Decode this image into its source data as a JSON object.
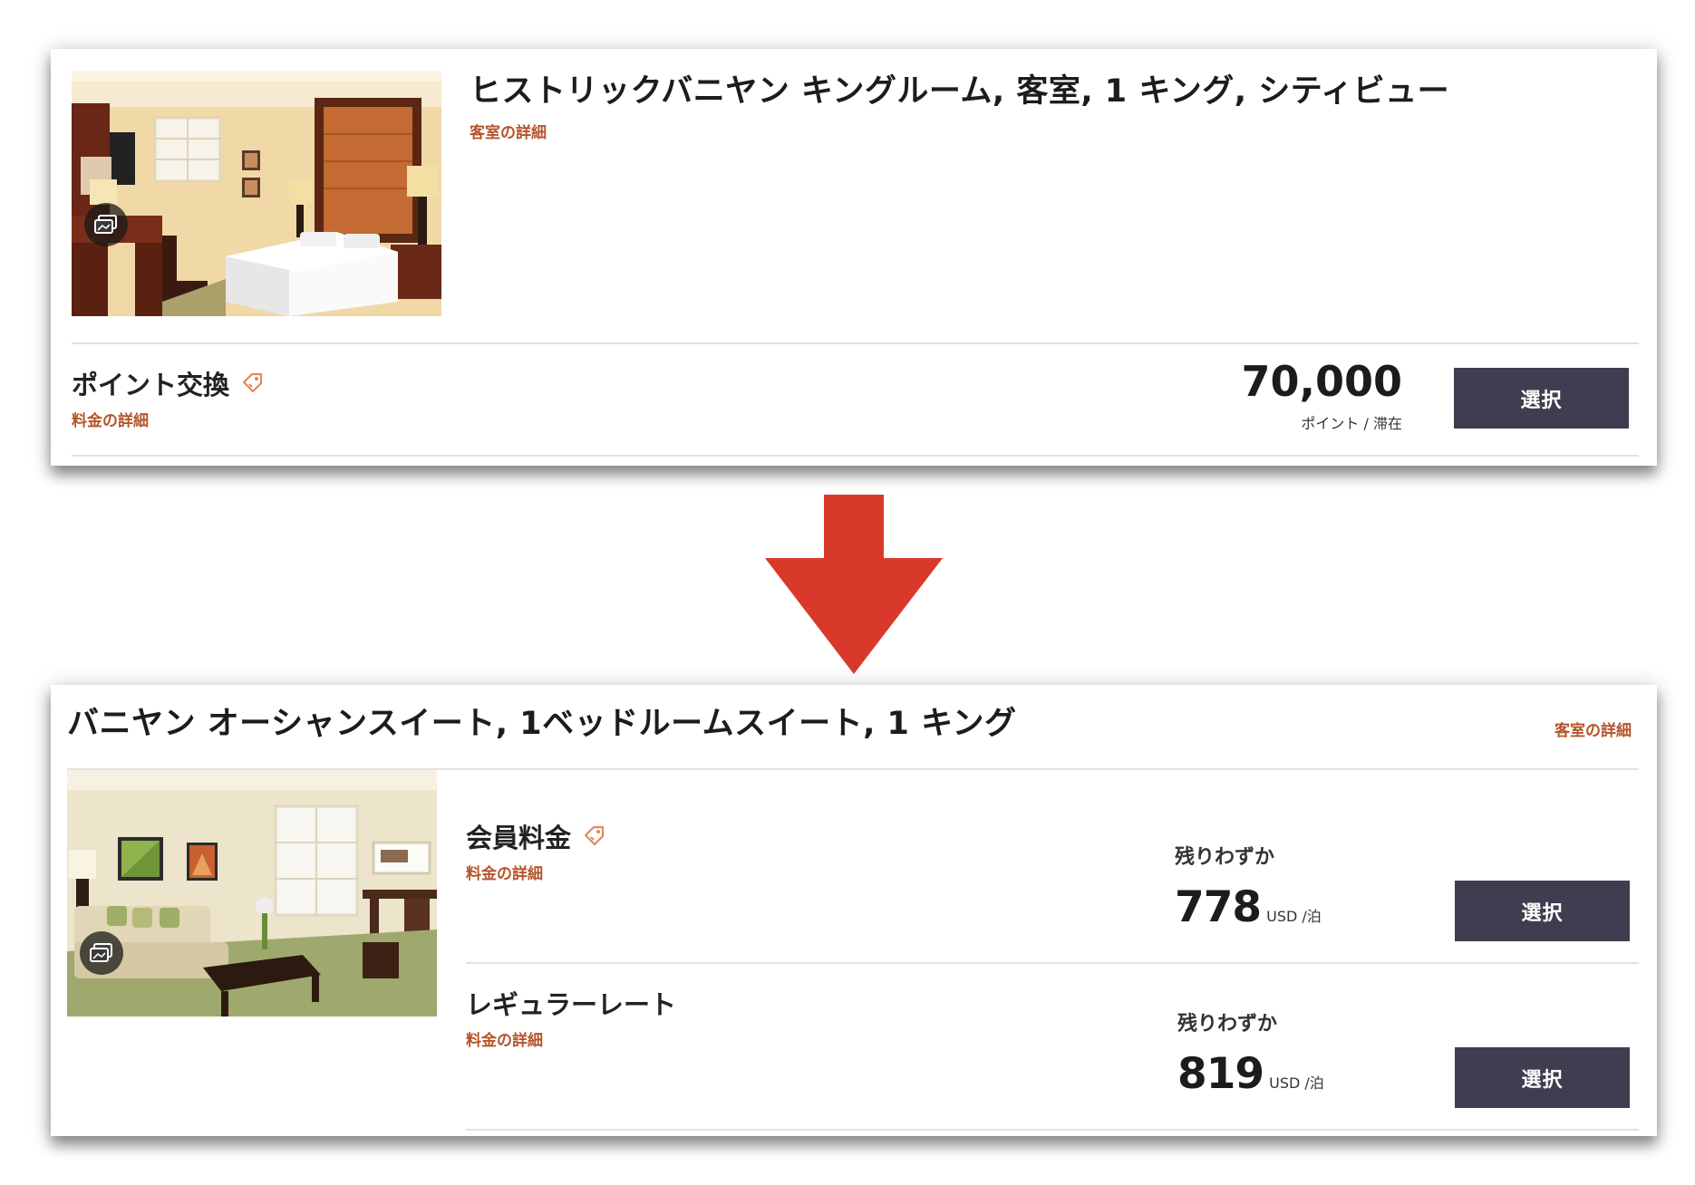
{
  "before": {
    "room_title": "ヒストリックバニヤン キングルーム, 客室, 1 キング, シティビュー",
    "room_details_link": "客室の詳細",
    "rate": {
      "name": "ポイント交換",
      "details_link": "料金の詳細",
      "amount": "70,000",
      "unit": "ポイント / 滞在",
      "select_label": "選択"
    }
  },
  "after": {
    "room_title": "バニヤン オーシャンスイート, 1ベッドルームスイート, 1 キング",
    "room_details_link": "客室の詳細",
    "rates": [
      {
        "name": "会員料金",
        "details_link": "料金の詳細",
        "availability": "残りわずか",
        "price": "778",
        "unit": "USD /泊",
        "select_label": "選択"
      },
      {
        "name": "レギュラーレート",
        "details_link": "料金の詳細",
        "availability": "残りわずか",
        "price": "819",
        "unit": "USD /泊",
        "select_label": "選択"
      }
    ]
  },
  "colors": {
    "arrow": "#d9392a",
    "link": "#b5542a",
    "button": "#3f3d4f",
    "tag": "#e28a55"
  },
  "icons": [
    "photo-gallery-icon",
    "offer-tag-icon",
    "down-arrow-icon"
  ]
}
